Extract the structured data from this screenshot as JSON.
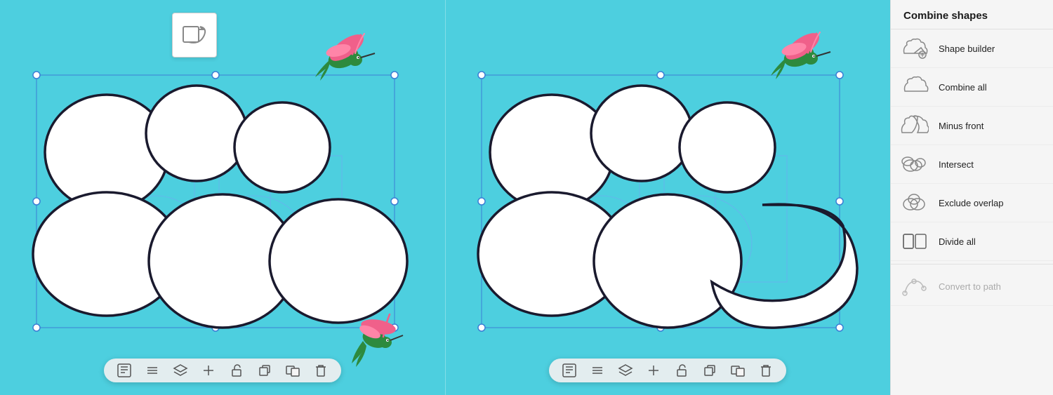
{
  "sidebar": {
    "title": "Combine shapes",
    "items": [
      {
        "id": "shape-builder",
        "label": "Shape builder",
        "icon": "shape-builder-icon",
        "disabled": false,
        "active": false
      },
      {
        "id": "combine-all",
        "label": "Combine all",
        "icon": "combine-all-icon",
        "disabled": false,
        "active": false
      },
      {
        "id": "minus-front",
        "label": "Minus front",
        "icon": "minus-front-icon",
        "disabled": false,
        "active": false
      },
      {
        "id": "intersect",
        "label": "Intersect",
        "icon": "intersect-icon",
        "disabled": false,
        "active": false
      },
      {
        "id": "exclude-overlap",
        "label": "Exclude overlap",
        "icon": "exclude-overlap-icon",
        "disabled": false,
        "active": false
      },
      {
        "id": "divide-all",
        "label": "Divide all",
        "icon": "divide-all-icon",
        "disabled": false,
        "active": false
      },
      {
        "id": "convert-to-path",
        "label": "Convert to path",
        "icon": "convert-to-path-icon",
        "disabled": true,
        "active": false
      }
    ]
  },
  "toolbar": {
    "buttons": [
      "select-mode",
      "list-view",
      "layers",
      "add",
      "unlock",
      "duplicate",
      "group-duplicate",
      "delete"
    ]
  },
  "canvas": {
    "background_color": "#4dcfdf"
  }
}
